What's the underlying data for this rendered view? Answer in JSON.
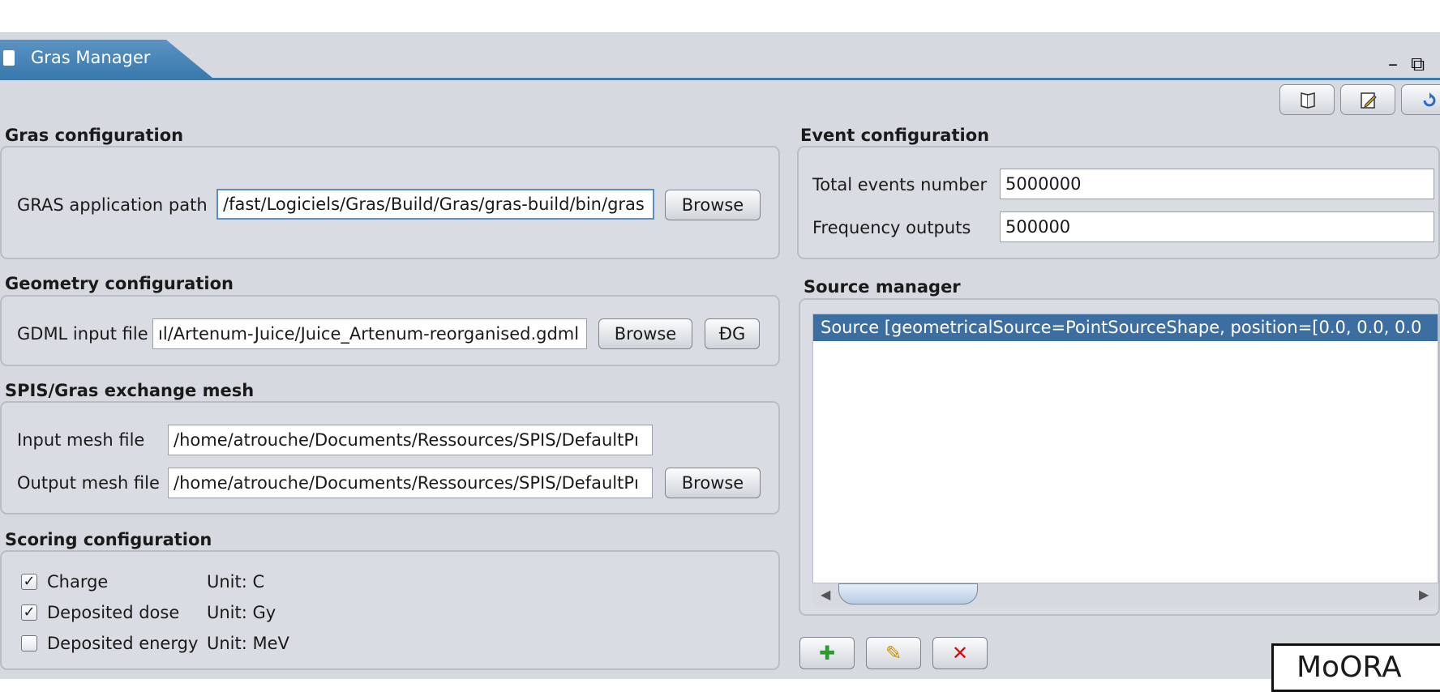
{
  "window": {
    "tab_title": "Gras Manager",
    "minimize_glyph": "–",
    "restore_glyph": "⧉"
  },
  "toolbar": {
    "icons": [
      "book-icon",
      "edit-icon",
      "refresh-icon"
    ]
  },
  "gras_config": {
    "title": "Gras configuration",
    "path_label": "GRAS application path",
    "path_value": "/fast/Logiciels/Gras/Build/Gras/gras-build/bin/gras",
    "browse_label": "Browse"
  },
  "geometry_config": {
    "title": "Geometry configuration",
    "gdml_label": "GDML input file",
    "gdml_value": "ıl/Artenum-Juice/Juice_Artenum-reorganised.gdml",
    "browse_label": "Browse",
    "dg_label": "ÐG"
  },
  "mesh_config": {
    "title": "SPIS/Gras exchange mesh",
    "input_label": "Input mesh file",
    "input_value": "/home/atrouche/Documents/Ressources/SPIS/DefaultPı",
    "output_label": "Output mesh file",
    "output_value": "/home/atrouche/Documents/Ressources/SPIS/DefaultPı",
    "browse_label": "Browse"
  },
  "scoring_config": {
    "title": "Scoring configuration",
    "items": [
      {
        "label": "Charge",
        "unit": "Unit: C",
        "checked": true,
        "mark": "✓"
      },
      {
        "label": "Deposited dose",
        "unit": "Unit: Gy",
        "checked": true,
        "mark": "✓"
      },
      {
        "label": "Deposited energy",
        "unit": "Unit: MeV",
        "checked": false,
        "mark": ""
      }
    ]
  },
  "event_config": {
    "title": "Event configuration",
    "total_label": "Total events number",
    "total_value": "5000000",
    "freq_label": "Frequency outputs",
    "freq_value": "500000"
  },
  "source_manager": {
    "title": "Source manager",
    "rows": [
      "Source [geometricalSource=PointSourceShape, position=[0.0, 0.0, 0.0"
    ],
    "scroll_left": "◀",
    "scroll_right": "▶",
    "add_glyph": "✚",
    "edit_glyph": "✎",
    "delete_glyph": "✕",
    "colors": {
      "add": "#2e9a2e",
      "edit": "#c89400",
      "delete": "#cc1010",
      "selection": "#3d6ea1"
    }
  },
  "overlay": {
    "badge_text": "MoORA"
  }
}
